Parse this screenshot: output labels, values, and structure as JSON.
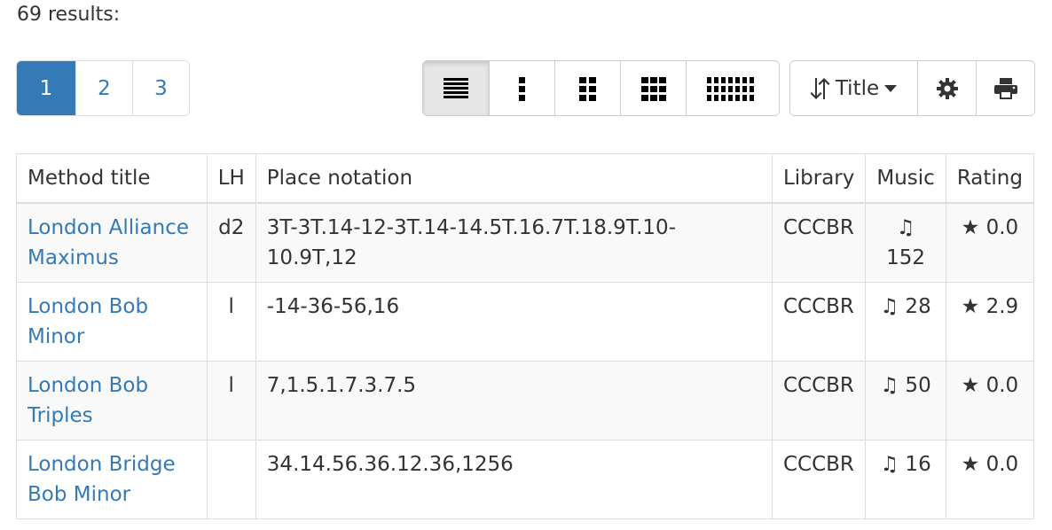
{
  "results_text": "69 results:",
  "pagination": [
    "1",
    "2",
    "3"
  ],
  "sort": {
    "label": "Title"
  },
  "table": {
    "headers": [
      "Method title",
      "LH",
      "Place notation",
      "Library",
      "Music",
      "Rating"
    ],
    "rows": [
      {
        "title_line1": "London Alliance",
        "title_line2": "Maximus",
        "lh": "d2",
        "place_notation": "3T-3T.14-12-3T.14-14.5T.16.7T.18.9T.10-10.9T,12",
        "library": "CCCBR",
        "music": "♫ 152",
        "rating": "★ 0.0"
      },
      {
        "title_line1": "London Bob",
        "title_line2": "Minor",
        "lh": "l",
        "place_notation": "-14-36-56,16",
        "library": "CCCBR",
        "music": "♫ 28",
        "rating": "★ 2.9"
      },
      {
        "title_line1": "London Bob",
        "title_line2": "Triples",
        "lh": "l",
        "place_notation": "7,1.5.1.7.3.7.5",
        "library": "CCCBR",
        "music": "♫ 50",
        "rating": "★ 0.0"
      },
      {
        "title_line1": "London Bridge",
        "title_line2": "Bob Minor",
        "lh": "",
        "place_notation": "34.14.56.36.12.36,1256",
        "library": "CCCBR",
        "music": "♫ 16",
        "rating": "★ 0.0"
      }
    ]
  },
  "icons": {
    "views": [
      "list-icon",
      "single-column-icon",
      "small-grid-icon",
      "medium-grid-icon",
      "large-grid-icon"
    ],
    "tools": [
      "sort-icon",
      "caret-down-icon",
      "gear-icon",
      "print-icon"
    ]
  },
  "colors": {
    "link": "#337ab7",
    "active_page": "#337ab7"
  }
}
